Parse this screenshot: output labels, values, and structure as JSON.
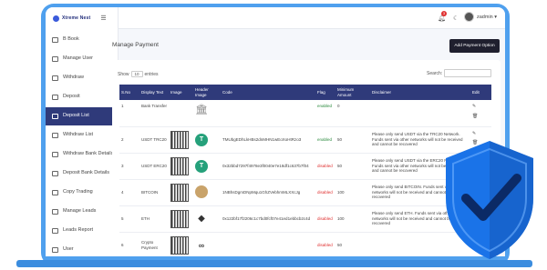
{
  "brand": {
    "name": "Xtreme Nest"
  },
  "sidebar": {
    "items": [
      {
        "label": "B Book",
        "icon": "book-icon"
      },
      {
        "label": "Manage User",
        "icon": "user-icon"
      },
      {
        "label": "Withdraw",
        "icon": "withdraw-icon"
      },
      {
        "label": "Deposit",
        "icon": "deposit-icon"
      },
      {
        "label": "Deposit List",
        "icon": "list-icon",
        "active": true
      },
      {
        "label": "Withdraw List",
        "icon": "list-icon"
      },
      {
        "label": "Withdraw Bank Details",
        "icon": "bank-icon"
      },
      {
        "label": "Deposit Bank Details",
        "icon": "bank-icon"
      },
      {
        "label": "Copy Trading",
        "icon": "copy-icon"
      },
      {
        "label": "Manage Leads",
        "icon": "leads-icon"
      },
      {
        "label": "Leads Report",
        "icon": "report-icon"
      },
      {
        "label": "User",
        "icon": "user-icon"
      }
    ]
  },
  "topbar": {
    "notification_count": "3",
    "user_name": "zadmin"
  },
  "page": {
    "title": "Manage Payment",
    "add_button": "Add Payment Option"
  },
  "table_controls": {
    "show_prefix": "Show",
    "show_value": "10",
    "show_suffix": "entries",
    "search_label": "Search:"
  },
  "table": {
    "headers": [
      "S.No",
      "Display Text",
      "Image",
      "Header Image",
      "Code",
      "Flag",
      "Minimum Amount",
      "Disclaimer",
      "Edit"
    ],
    "rows": [
      {
        "sno": "1",
        "display": "Bank Transfer",
        "header_image": "bank",
        "code": "",
        "flag": "enabled",
        "min": "0",
        "disclaimer": ""
      },
      {
        "sno": "2",
        "display": "USDT TRC20",
        "header_image": "tether",
        "code": "TMUbgEDhLkHBs2dnMHN1wEoXoHtRzo3",
        "flag": "enabled",
        "min": "50",
        "disclaimer": "Please only send USDT via the TRC20 Network. Funds sent via other networks will not be received and cannot be recovered"
      },
      {
        "sno": "3",
        "display": "USDT ERC20",
        "header_image": "tether",
        "code": "0x32bbd7297f4978e3f0040e7e18df1c637b7f04",
        "flag": "disabled",
        "min": "50",
        "disclaimer": "Please only send USDT via the ERC20 Network. Funds sent via other networks will not be received and cannot be recovered"
      },
      {
        "sno": "4",
        "display": "BITCOIN",
        "header_image": "bitcoin",
        "code": "1NBhsDgmDNpMqu1GhZVebhmMLXXcJg",
        "flag": "disabled",
        "min": "100",
        "disclaimer": "Please only send BITCOIN. Funds sent via other networks will not be received and cannot be recovered"
      },
      {
        "sno": "5",
        "display": "ETH",
        "header_image": "ethereum",
        "code": "0x122bf17f2206c1c7bd0fcf07e41ed1ebbcb2c4d",
        "flag": "disabled",
        "min": "100",
        "disclaimer": "Please only send ETH. Funds sent via other networks will not be received and cannot be recovered"
      },
      {
        "sno": "6",
        "display": "Crypto Payment",
        "header_image": "chainlink",
        "code": "",
        "flag": "disabled",
        "min": "50",
        "disclaimer": ""
      }
    ]
  },
  "colors": {
    "frame": "#4fa0ee",
    "sidebar_active": "#2f3a7a",
    "table_header": "#2f3a7a",
    "enabled": "#2b8a3e",
    "disabled": "#e03131",
    "shield": "#1a73e8"
  }
}
